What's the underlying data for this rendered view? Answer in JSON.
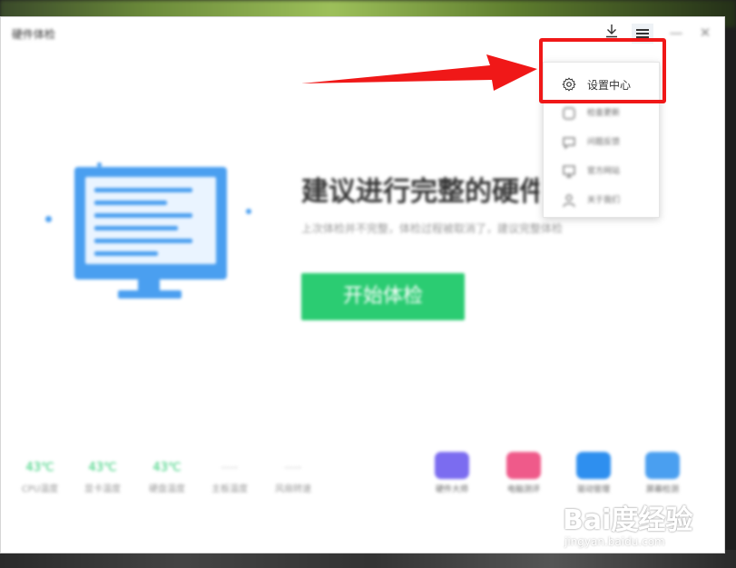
{
  "window": {
    "title": "硬件体检",
    "minimize_glyph": "—",
    "close_glyph": "✕"
  },
  "toolbar": {
    "download_icon": "download-icon",
    "menu_icon": "hamburger-menu-icon"
  },
  "menu": {
    "items": [
      {
        "label": "设置中心",
        "icon": "gear-icon"
      },
      {
        "label": "检查更新",
        "icon": "refresh-icon"
      },
      {
        "label": "问题反馈",
        "icon": "feedback-icon"
      },
      {
        "label": "官方网站",
        "icon": "monitor-icon"
      },
      {
        "label": "关于我们",
        "icon": "user-icon"
      }
    ]
  },
  "main": {
    "headline": "建议进行完整的硬件",
    "subline": "上次体检并不完整，体检过程被取消了，建议完整体检",
    "start_button": "开始体检"
  },
  "stats": [
    {
      "value": "43℃",
      "label": "CPU温度"
    },
    {
      "value": "43℃",
      "label": "显卡温度"
    },
    {
      "value": "43℃",
      "label": "硬盘温度"
    },
    {
      "value": "----",
      "label": "主板温度"
    },
    {
      "value": "----",
      "label": "风扇转速"
    }
  ],
  "tools": [
    {
      "label": "硬件大师",
      "color": "#7b6cf0"
    },
    {
      "label": "电脑测评",
      "color": "#ef5a8a"
    },
    {
      "label": "驱动管理",
      "color": "#2e8fef"
    },
    {
      "label": "屏幕检测",
      "color": "#4a9ff0"
    }
  ],
  "colors": {
    "accent_green": "#2bcc72",
    "accent_blue": "#4a9ff0",
    "highlight_red": "#f01818"
  },
  "watermark": {
    "brand": "Bai度经验",
    "url": "jingyan.baidu.com"
  }
}
